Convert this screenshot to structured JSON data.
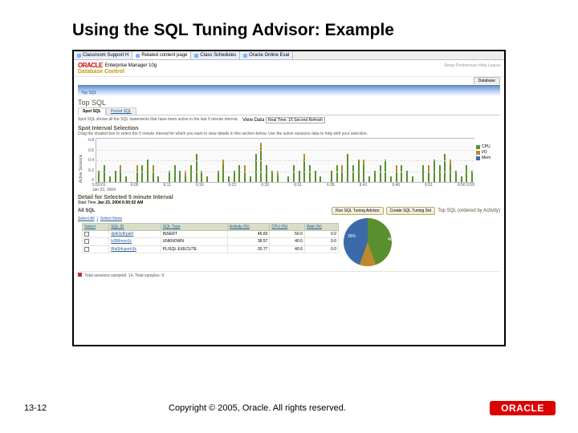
{
  "slide": {
    "title": "Using the SQL Tuning Advisor: Example",
    "page_num": "13-12",
    "copyright": "Copyright © 2005, Oracle. All rights reserved.",
    "footer_logo": "ORACLE"
  },
  "colors": {
    "cpu": "#5a8f2e",
    "io": "#bb8a2a",
    "mem": "#3a6ba8"
  },
  "browser": {
    "tabs": [
      "Classroom Support H",
      "Related content page",
      "Class Schedules",
      "Oracle Online Eval"
    ]
  },
  "app": {
    "logo": "ORACLE",
    "product": "Enterprise Manager 10g",
    "subtitle": "Database Control",
    "nav_tab": "Database",
    "breadcrumb": "Top SQL",
    "page_title": "Top SQL",
    "sub_tabs": {
      "active": "Spot SQL",
      "other": "Period SQL"
    },
    "view_data_label": "View Data",
    "view_data_value": "Real Time: 15 Second Refresh",
    "spot_desc": "Spot SQL shows all the SQL statements that have been active in the last 5 minute interval.",
    "spot_title": "Spot Interval Selection",
    "spot_help": "Drag the shaded box to select the 5 minute interval for which you want to view details in this section below. Use the active sessions data to help with your selection."
  },
  "chart_data": {
    "type": "bar",
    "ylabel": "Active Sessions",
    "yticks": [
      "0.8",
      "0.6",
      "0.4",
      "0.2",
      "0"
    ],
    "ylim": [
      0,
      0.8
    ],
    "xticks": [
      "5:59:01",
      "6:05",
      "6:11",
      "6:16",
      "6:21",
      "6:26",
      "6:31",
      "6:36",
      "6:41",
      "6:46",
      "6:51",
      "6:56 6:59"
    ],
    "xdate": "Jan 23, 2004",
    "series": [
      {
        "name": "CPU",
        "color": "#5a8f2e"
      },
      {
        "name": "I/O",
        "color": "#bb8a2a"
      },
      {
        "name": "Mem",
        "color": "#3a6ba8"
      }
    ],
    "stacks": [
      [
        0.2,
        0.0,
        0.0
      ],
      [
        0.3,
        0.0,
        0.0
      ],
      [
        0.1,
        0.0,
        0.0
      ],
      [
        0.2,
        0.0,
        0.0
      ],
      [
        0.2,
        0.1,
        0.0
      ],
      [
        0.1,
        0.0,
        0.0
      ],
      [
        0.0,
        0.0,
        0.0
      ],
      [
        0.2,
        0.1,
        0.0
      ],
      [
        0.3,
        0.0,
        0.0
      ],
      [
        0.4,
        0.0,
        0.0
      ],
      [
        0.2,
        0.1,
        0.0
      ],
      [
        0.1,
        0.0,
        0.0
      ],
      [
        0.0,
        0.0,
        0.0
      ],
      [
        0.2,
        0.0,
        0.0
      ],
      [
        0.3,
        0.0,
        0.0
      ],
      [
        0.2,
        0.0,
        0.0
      ],
      [
        0.1,
        0.1,
        0.0
      ],
      [
        0.3,
        0.0,
        0.0
      ],
      [
        0.5,
        0.0,
        0.0
      ],
      [
        0.2,
        0.0,
        0.0
      ],
      [
        0.1,
        0.0,
        0.0
      ],
      [
        0.0,
        0.0,
        0.0
      ],
      [
        0.2,
        0.0,
        0.0
      ],
      [
        0.3,
        0.1,
        0.0
      ],
      [
        0.1,
        0.0,
        0.0
      ],
      [
        0.2,
        0.0,
        0.0
      ],
      [
        0.3,
        0.0,
        0.0
      ],
      [
        0.2,
        0.1,
        0.0
      ],
      [
        0.1,
        0.0,
        0.0
      ],
      [
        0.5,
        0.0,
        0.0
      ],
      [
        0.6,
        0.1,
        0.0
      ],
      [
        0.3,
        0.0,
        0.0
      ],
      [
        0.2,
        0.0,
        0.0
      ],
      [
        0.1,
        0.1,
        0.0
      ],
      [
        0.0,
        0.0,
        0.0
      ],
      [
        0.1,
        0.0,
        0.0
      ],
      [
        0.3,
        0.0,
        0.0
      ],
      [
        0.2,
        0.0,
        0.0
      ],
      [
        0.4,
        0.1,
        0.0
      ],
      [
        0.3,
        0.0,
        0.0
      ],
      [
        0.2,
        0.0,
        0.0
      ],
      [
        0.1,
        0.0,
        0.0
      ],
      [
        0.0,
        0.0,
        0.0
      ],
      [
        0.2,
        0.0,
        0.0
      ],
      [
        0.3,
        0.0,
        0.0
      ],
      [
        0.2,
        0.1,
        0.0
      ],
      [
        0.5,
        0.0,
        0.0
      ],
      [
        0.3,
        0.0,
        0.0
      ],
      [
        0.4,
        0.0,
        0.0
      ],
      [
        0.3,
        0.1,
        0.0
      ],
      [
        0.1,
        0.0,
        0.0
      ],
      [
        0.2,
        0.0,
        0.0
      ],
      [
        0.3,
        0.0,
        0.0
      ],
      [
        0.4,
        0.0,
        0.0
      ],
      [
        0.1,
        0.0,
        0.0
      ],
      [
        0.2,
        0.1,
        0.0
      ],
      [
        0.3,
        0.0,
        0.0
      ],
      [
        0.2,
        0.0,
        0.0
      ],
      [
        0.1,
        0.0,
        0.0
      ],
      [
        0.0,
        0.0,
        0.0
      ],
      [
        0.3,
        0.0,
        0.0
      ],
      [
        0.2,
        0.1,
        0.0
      ],
      [
        0.4,
        0.0,
        0.0
      ],
      [
        0.3,
        0.0,
        0.0
      ],
      [
        0.5,
        0.0,
        0.0
      ],
      [
        0.3,
        0.1,
        0.0
      ],
      [
        0.2,
        0.0,
        0.0
      ],
      [
        0.1,
        0.0,
        0.0
      ],
      [
        0.3,
        0.0,
        0.0
      ],
      [
        0.2,
        0.0,
        0.0
      ]
    ]
  },
  "detail": {
    "title": "Detail for Selected 5 minute Interval",
    "start_label": "Start Time",
    "start_value": "Jan 23, 2004 6:50:02 AM",
    "all_sql": "All SQL",
    "btn_advisor": "Run SQL Tuning Advisor",
    "btn_tuning_set": "Create SQL Tuning Set",
    "right_label": "Top SQL (ordered by Activity)",
    "actions": {
      "select_all": "Select All",
      "select_none": "Select None"
    },
    "headers": [
      "Select",
      "SQL ID",
      "SQL Type",
      "Activity (%)",
      "CPU (%)",
      "Wait (%)"
    ],
    "rows": [
      {
        "id": "djdk3y8rjak0",
        "type": "INSERT",
        "activity": "45.83",
        "cpu": "50.0",
        "wait": "0.0"
      },
      {
        "id": "b390mvn1c",
        "type": "UNKNOWN",
        "activity": "38.57",
        "cpu": "40.0",
        "wait": "0.0"
      },
      {
        "id": "8hd34cporh1k",
        "type": "PL/SQL EXECUTE",
        "activity": "20.77",
        "cpu": "40.0",
        "wait": "0.0"
      }
    ],
    "pie": {
      "labels": [
        "36%",
        "46%"
      ],
      "slices": [
        46,
        18,
        36
      ]
    },
    "status_bar": "Total sessions sampled: 14, Total samples: 9"
  }
}
